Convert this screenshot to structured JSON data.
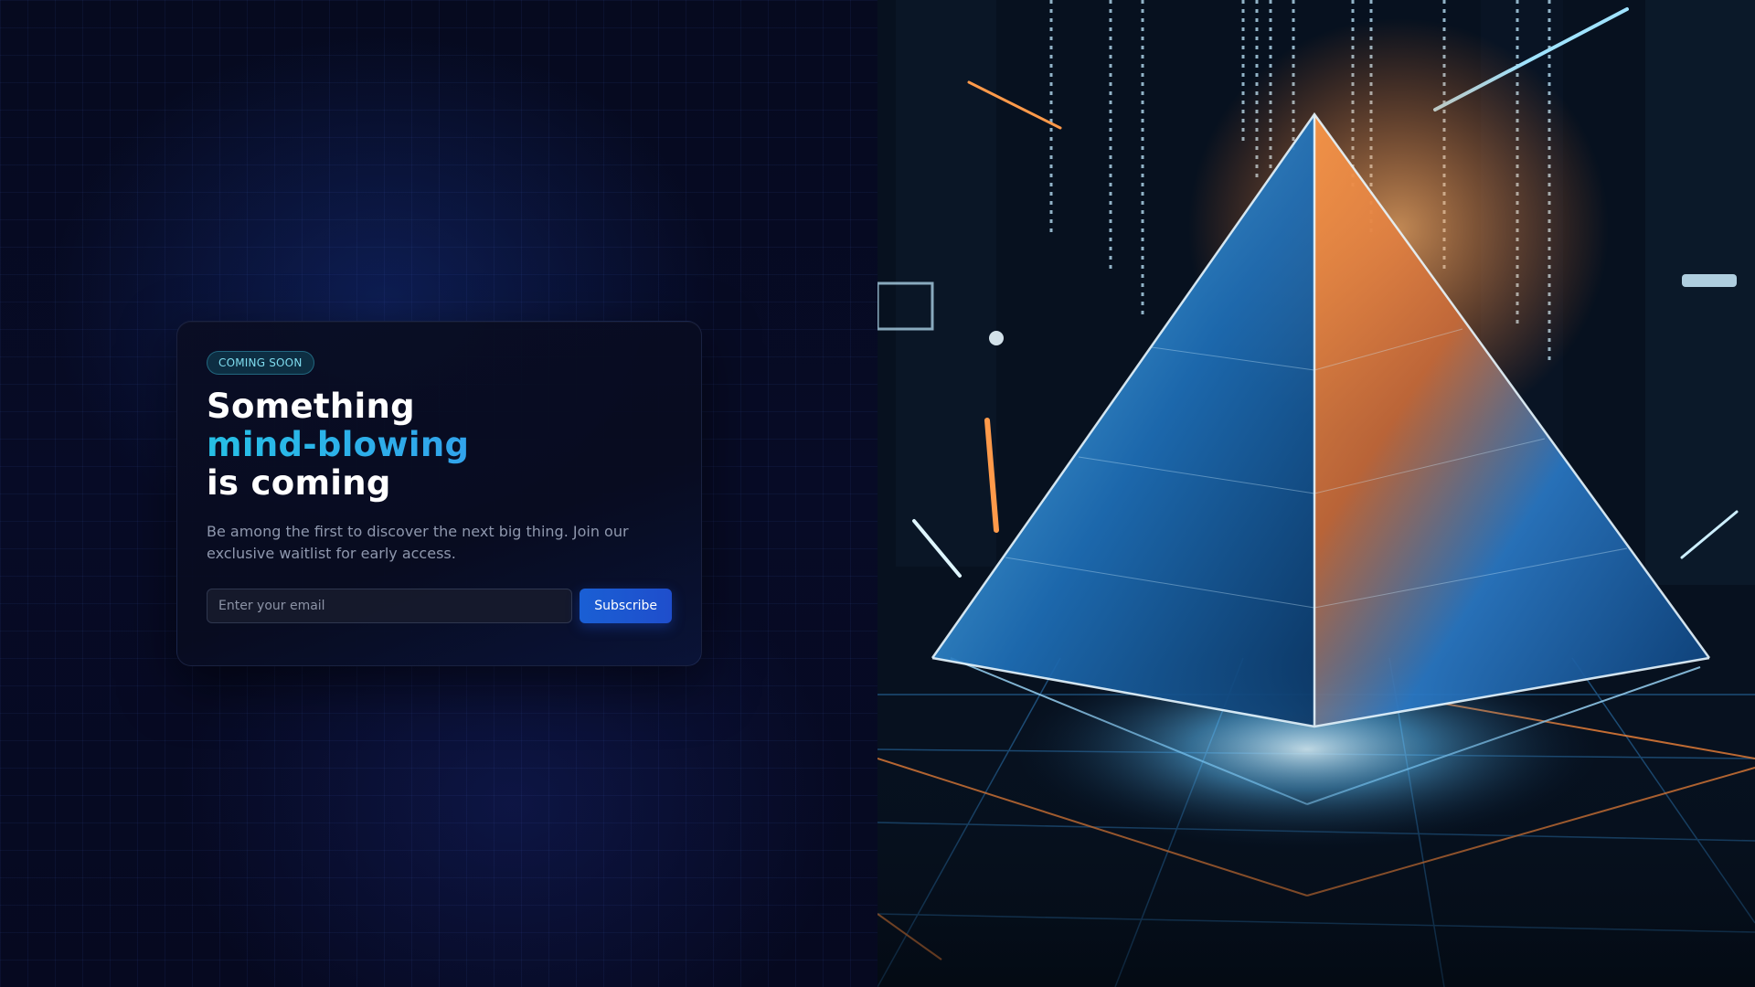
{
  "badge": {
    "label": "COMING SOON"
  },
  "headline": {
    "line1": "Something",
    "line2": "mind-blowing",
    "line3": "is coming"
  },
  "description": "Be among the first to discover the next big thing. Join our exclusive waitlist for early access.",
  "form": {
    "email_placeholder": "Enter your email",
    "email_value": "",
    "subscribe_label": "Subscribe"
  },
  "colors": {
    "background": "#06091f",
    "accent_start": "#26c0e6",
    "accent_end": "#3a8df0",
    "button": "#1a5fd4",
    "badge_text": "#7fdcef"
  },
  "hero": {
    "icon": "glowing-pyramid-illustration"
  }
}
